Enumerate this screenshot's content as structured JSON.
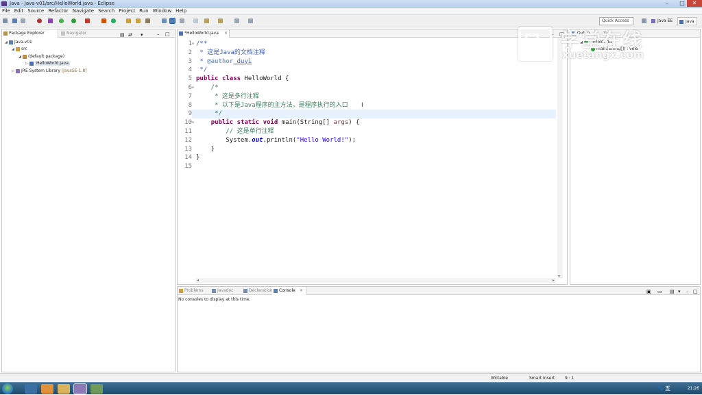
{
  "window": {
    "title": "Java - Java-v01/src/HelloWorld.java - Eclipse"
  },
  "menu": [
    "File",
    "Edit",
    "Source",
    "Refactor",
    "Navigate",
    "Search",
    "Project",
    "Run",
    "Window",
    "Help"
  ],
  "toolbar": {
    "quick_access_placeholder": "Quick Access",
    "perspectives": [
      "Java EE",
      "Java"
    ]
  },
  "package_explorer": {
    "tabs": [
      "Package Explorer",
      "Navigator"
    ],
    "tree": {
      "project": "Java-v01",
      "src": "src",
      "package": "(default package)",
      "file": "HelloWorld.java",
      "jre": "JRE System Library",
      "jre_version": "[JavaSE-1.8]"
    }
  },
  "editor": {
    "tab": "*HelloWorld.java",
    "lines": [
      {
        "n": "1",
        "text": "/**"
      },
      {
        "n": "2",
        "text": " * 这是Java的文档注释"
      },
      {
        "n": "3",
        "text": " * @author duyi"
      },
      {
        "n": "4",
        "text": " */"
      },
      {
        "n": "5",
        "text": "public class HelloWorld {"
      },
      {
        "n": "6",
        "text": "    /*"
      },
      {
        "n": "7",
        "text": "     * 这是多行注释"
      },
      {
        "n": "8",
        "text": "     * 以下是Java程序的主方法，是程序执行的入口"
      },
      {
        "n": "9",
        "text": "     */"
      },
      {
        "n": "10",
        "text": "    public static void main(String[] args) {"
      },
      {
        "n": "11",
        "text": "        // 这是单行注释"
      },
      {
        "n": "12",
        "text": "        System.out.println(\"Hello World!\");"
      },
      {
        "n": "13",
        "text": "    }"
      },
      {
        "n": "14",
        "text": "}"
      },
      {
        "n": "15",
        "text": ""
      }
    ],
    "tokens": {
      "l1": "/**",
      "l2": " * 这是Java的文档注释",
      "l3a": " * ",
      "l3b": "@author",
      "l3c": " duyi",
      "l4": " */",
      "l5a": "public",
      "l5b": " ",
      "l5c": "class",
      "l5d": " HelloWorld {",
      "l6": "    /*",
      "l7": "     * 这是多行注释",
      "l8": "     * 以下是Java程序的主方法，是程序执行的入口",
      "l9": "     */",
      "l10a": "    ",
      "l10b": "public",
      "l10c": "static",
      "l10d": "void",
      "l10e": " main(String[] ",
      "l10f": "args",
      "l10g": ") {",
      "l11": "        // 这是单行注释",
      "l12a": "        System.",
      "l12b": "out",
      "l12c": ".println(",
      "l12d": "\"Hello World!\"",
      "l12e": ");",
      "l13": "    }",
      "l14": "}"
    }
  },
  "outline": {
    "tabs": [
      "Outline",
      "Ta"
    ],
    "class": "HelloWorld",
    "method": "main(String[]) : void"
  },
  "console": {
    "tabs": [
      "Problems",
      "Javadoc",
      "Declaration",
      "Console"
    ],
    "message": "No consoles to display at this time."
  },
  "status": {
    "mode": "Writable",
    "insert": "Smart Insert",
    "position": "9 : 1"
  },
  "taskbar": {
    "clock": "21:26",
    "ime": "五"
  },
  "watermark": {
    "cn": "学堂在线",
    "en": "xuetangx.com"
  },
  "colors": {
    "keyword": "#7f0055",
    "comment": "#3f7f5f",
    "javadoc": "#3f5fbf",
    "string": "#2a00ff",
    "field": "#0000c0"
  }
}
